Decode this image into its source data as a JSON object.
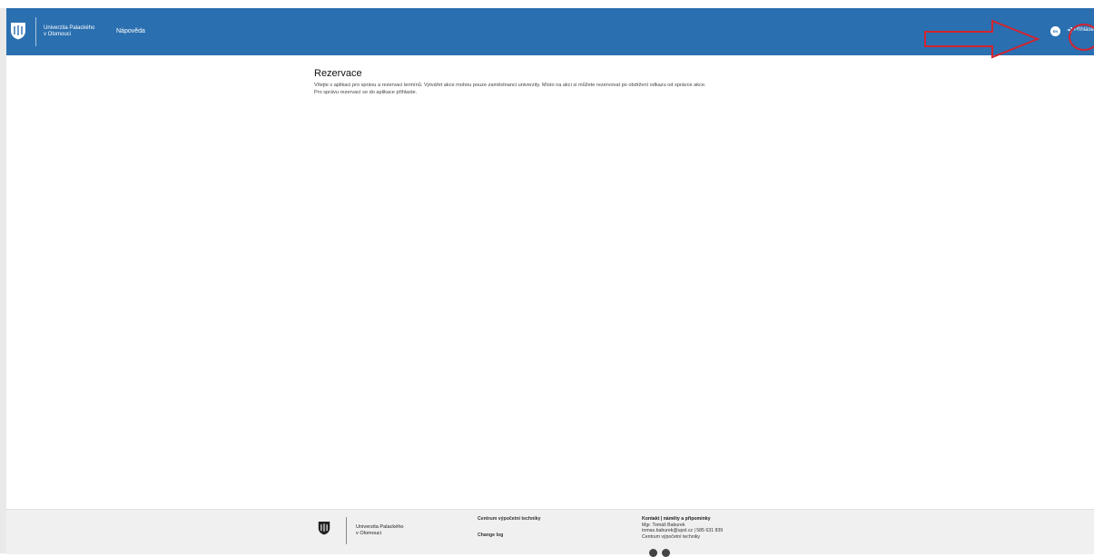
{
  "header": {
    "logo_line1": "Univerzita Palackého",
    "logo_line2": "v Olomouci",
    "nav_help": "Nápověda",
    "lang_label": "EN",
    "login_label": "Přihláse"
  },
  "main": {
    "title": "Rezervace",
    "intro_line1": "Vítejte v aplikaci pro správu a rezervaci termínů. Vytvářet akce mohou pouze zaměstnanci univerzity. Místo na akci si můžete rezervovat po obdržení odkazu od správce akce.",
    "intro_line2": "Pro správu rezervací se do aplikace přihlaste."
  },
  "footer": {
    "logo_line1": "Univerzita Palackého",
    "logo_line2": "v Olomouci",
    "col1_link1": "Centrum výpočetní techniky",
    "col1_link2": "Change log",
    "contact_head": "Kontakt | náměty a připomínky",
    "contact_name": "Mgr. Tomáš Baburek",
    "contact_email_phone": "tomas.baburek@upol.cz | 585 631 839",
    "contact_dept": "Centrum výpočetní techniky"
  },
  "colors": {
    "header_bg": "#2a6fb0",
    "annotation": "#d3232e"
  },
  "icons": {
    "lang": "globe-icon",
    "login": "sign-in-icon",
    "social1": "facebook-icon",
    "social2": "instagram-icon"
  }
}
